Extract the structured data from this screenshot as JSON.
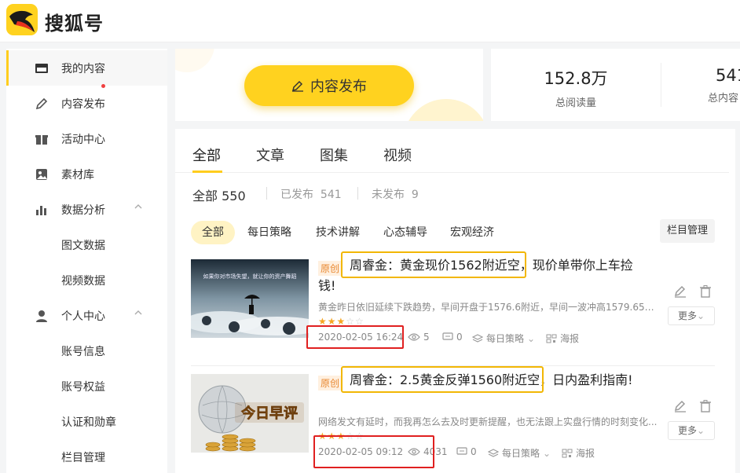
{
  "app": {
    "brand": "搜狐号",
    "colors": {
      "accent": "#ffcd1e",
      "highlight_box": "#f2b705",
      "alert_box": "#e02020",
      "badge": "#e8872f",
      "star": "#f5a623"
    }
  },
  "sidebar": {
    "items": [
      {
        "label": "我的内容",
        "icon": "content-icon"
      },
      {
        "label": "内容发布",
        "icon": "edit-icon"
      },
      {
        "label": "活动中心",
        "icon": "gift-icon"
      },
      {
        "label": "素材库",
        "icon": "image-library-icon"
      },
      {
        "label": "数据分析",
        "icon": "bar-chart-icon"
      },
      {
        "label": "图文数据"
      },
      {
        "label": "视频数据"
      },
      {
        "label": "个人中心",
        "icon": "user-icon"
      },
      {
        "label": "账号信息"
      },
      {
        "label": "账号权益"
      },
      {
        "label": "认证和勋章"
      },
      {
        "label": "栏目管理"
      }
    ]
  },
  "publish": {
    "label": "内容发布"
  },
  "stats": [
    {
      "value": "152.8万",
      "caption": "总阅读量"
    },
    {
      "value": "541",
      "caption": "总内容"
    }
  ],
  "tabs": [
    "全部",
    "文章",
    "图集",
    "视频"
  ],
  "counts": {
    "all_label": "全部",
    "all_value": "550",
    "published_label": "已发布",
    "published_value": "541",
    "unpublished_label": "未发布",
    "unpublished_value": "9"
  },
  "categories": [
    "全部",
    "每日策略",
    "技术讲解",
    "心态辅导",
    "宏观经济"
  ],
  "column_manage": "栏目管理",
  "articles": [
    {
      "badge": "原创",
      "title_highlight": "周睿金：黄金现价1562附近空，",
      "title_rest": "现价单带你上车捡",
      "title_line2": "钱!",
      "summary": "黄金昨日依旧延续下跌趋势，早间开盘于1576.6附近，早间一波冲高1579.65行...",
      "rating": 3,
      "date": "2020-02-05 16:24",
      "views": "5",
      "comments": "0",
      "column": "每日策略",
      "poster": "海报",
      "more": "更多",
      "thumb_caption": "如果你对市场失望，就让你的资产舞蹈"
    },
    {
      "badge": "原创",
      "title_highlight": "周睿金：2.5黄金反弹1560附近空，",
      "title_rest": "日内盈利指南!",
      "title_line2": "",
      "summary": "网络发文有延时，而我再怎么去及时更新提醒，也无法跟上实盘行情的时刻变化...",
      "rating": 3,
      "date": "2020-02-05 09:12",
      "views": "4031",
      "comments": "0",
      "column": "每日策略",
      "poster": "海报",
      "more": "更多",
      "thumb_caption": "今日早评"
    }
  ]
}
